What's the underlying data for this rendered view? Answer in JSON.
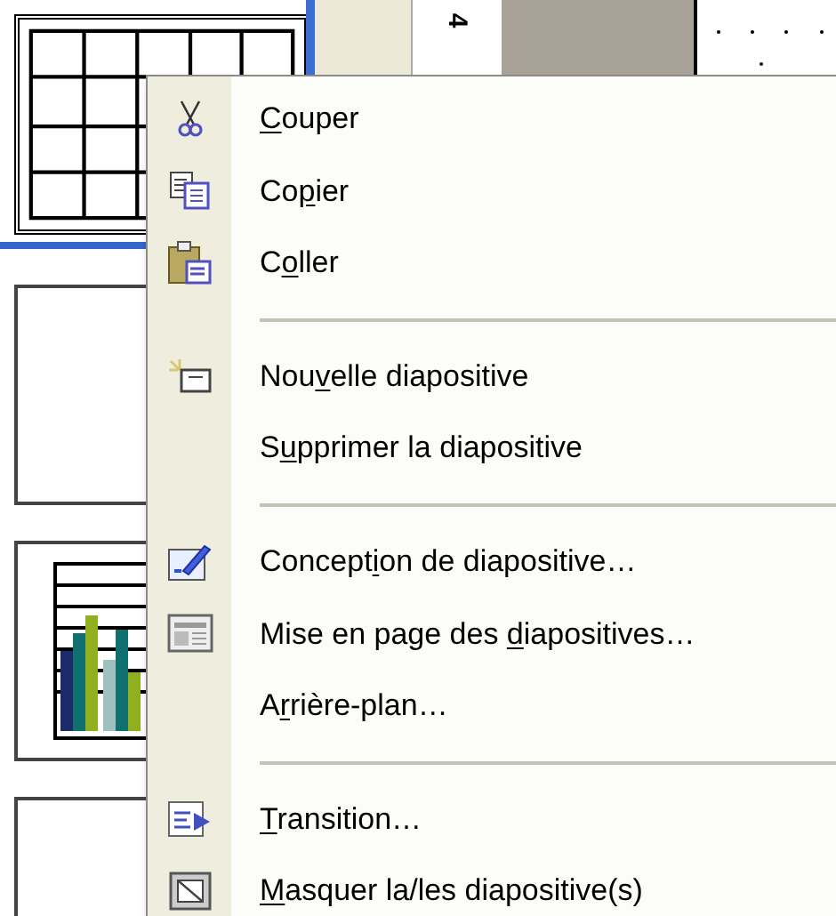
{
  "ruler": {
    "mark": "4"
  },
  "slides": [
    {
      "kind": "table",
      "selected": true
    },
    {
      "kind": "blank",
      "selected": false
    },
    {
      "kind": "chart",
      "selected": false
    },
    {
      "kind": "blank",
      "selected": false
    }
  ],
  "context_menu": {
    "items": [
      {
        "kind": "item",
        "access_key": "C",
        "label_end": "ouper"
      },
      {
        "kind": "item",
        "label_start": "Co",
        "access_key": "p",
        "label_end": "ier"
      },
      {
        "kind": "item",
        "label_start": "C",
        "access_key": "o",
        "label_end": "ller"
      },
      {
        "kind": "separator"
      },
      {
        "kind": "item",
        "label_start": "Nou",
        "access_key": "v",
        "label_end": "elle diapositive"
      },
      {
        "kind": "item",
        "label_start": "S",
        "access_key": "u",
        "label_end": "pprimer la diapositive"
      },
      {
        "kind": "separator"
      },
      {
        "kind": "item",
        "label_start": "Concept",
        "access_key": "i",
        "label_end": "on de diapositive…"
      },
      {
        "kind": "item",
        "label_start": "Mise en page des ",
        "access_key": "d",
        "label_end": "iapositives…"
      },
      {
        "kind": "item",
        "label_start": "A",
        "access_key": "r",
        "label_end": "rière-plan…"
      },
      {
        "kind": "separator"
      },
      {
        "kind": "item",
        "access_key": "T",
        "label_end": "ransition…"
      },
      {
        "kind": "item",
        "access_key": "M",
        "label_end": "asquer la/les diapositive(s)"
      }
    ]
  }
}
